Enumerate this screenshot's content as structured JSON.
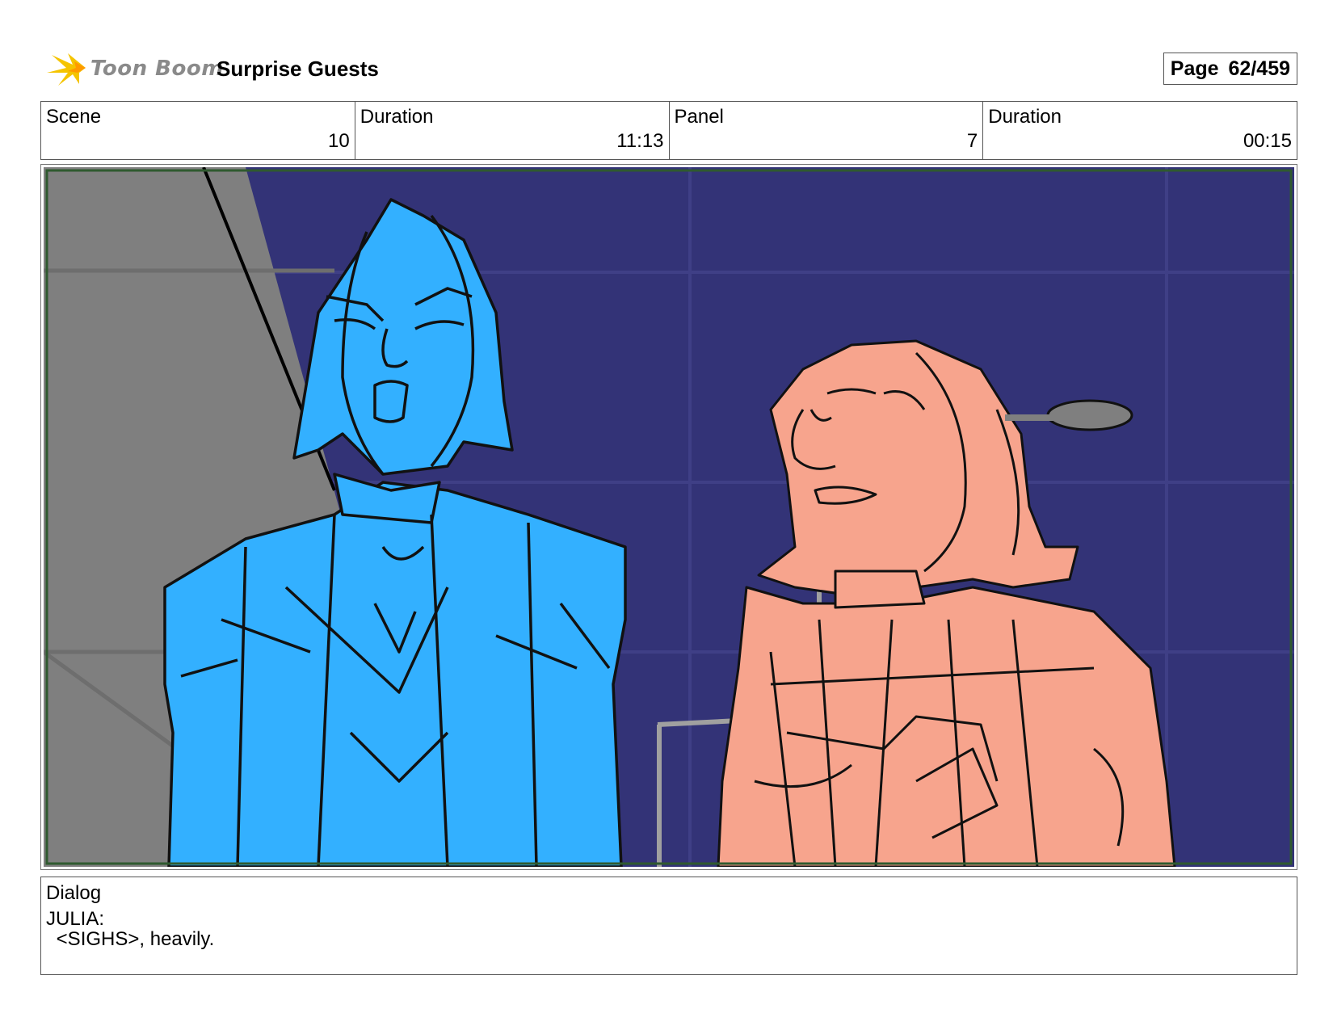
{
  "header": {
    "logo_text": "Toon Boom",
    "project_title": "Surprise Guests",
    "page_label": "Page",
    "page_number": "62/459"
  },
  "info": {
    "scene_label": "Scene",
    "scene_value": "10",
    "scene_duration_label": "Duration",
    "scene_duration_value": "11:13",
    "panel_label": "Panel",
    "panel_value": "7",
    "panel_duration_label": "Duration",
    "panel_duration_value": "00:15"
  },
  "dialog": {
    "label": "Dialog",
    "speaker": "JULIA:",
    "line": " <SIGHS>, heavily."
  },
  "colors": {
    "background_navy": "#333377",
    "wall_gray": "#7f7f7f",
    "character_blue": "#33b0ff",
    "character_peach": "#f7a48d",
    "frame_green": "#2f5a2f"
  }
}
